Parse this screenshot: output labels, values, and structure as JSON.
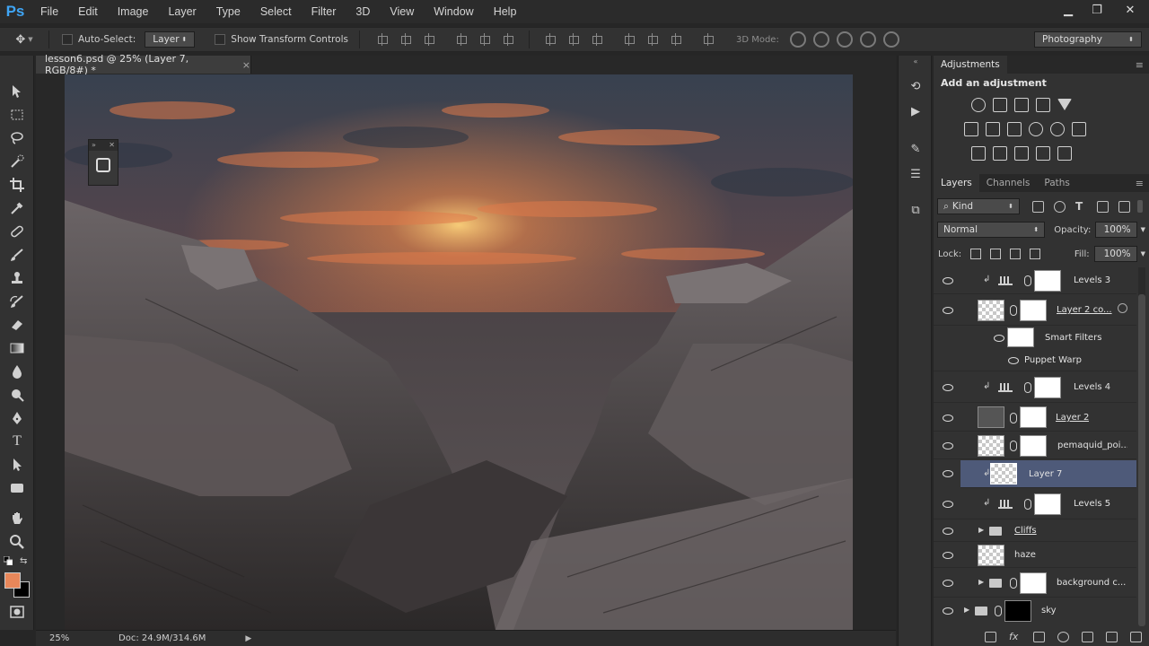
{
  "app": {
    "logo": "Ps",
    "menu": [
      "File",
      "Edit",
      "Image",
      "Layer",
      "Type",
      "Select",
      "Filter",
      "3D",
      "View",
      "Window",
      "Help"
    ],
    "window_controls": [
      "minimize",
      "restore",
      "close"
    ]
  },
  "options_bar": {
    "auto_select_label": "Auto-Select:",
    "auto_select_checked": false,
    "auto_select_value": "Layer",
    "show_transform_label": "Show Transform Controls",
    "show_transform_checked": false,
    "mode_3d_label": "3D Mode:",
    "workspace": "Photography"
  },
  "document": {
    "tab_title": "lesson6.psd @ 25% (Layer 7, RGB/8#) *",
    "close_glyph": "×",
    "zoom": "25%",
    "doc_info": "Doc: 24.9M/314.6M"
  },
  "colors": {
    "foreground": "#e8875a",
    "background": "#000000",
    "selected_layer": "#4e5a79",
    "accent": "#3fa5f5"
  },
  "tools": [
    "move-tool",
    "marquee-tool",
    "lasso-tool",
    "quick-selection-tool",
    "crop-tool",
    "eyedropper-tool",
    "healing-brush-tool",
    "brush-tool",
    "clone-stamp-tool",
    "history-brush-tool",
    "eraser-tool",
    "gradient-tool",
    "blur-tool",
    "dodge-tool",
    "pen-tool",
    "type-tool",
    "path-selection-tool",
    "rectangle-tool",
    "hand-tool",
    "zoom-tool"
  ],
  "adjustments": {
    "tab": "Adjustments",
    "title": "Add an adjustment"
  },
  "layers_panel": {
    "tabs": [
      "Layers",
      "Channels",
      "Paths"
    ],
    "filter_kind": "Kind",
    "blend_mode": "Normal",
    "opacity_label": "Opacity:",
    "opacity_value": "100%",
    "lock_label": "Lock:",
    "fill_label": "Fill:",
    "fill_value": "100%",
    "layers": [
      {
        "name": "Levels 3",
        "type": "adjustment",
        "clipped": true
      },
      {
        "name": "Layer 2 co...",
        "type": "smart-object",
        "underlined": true
      },
      {
        "name": "Smart Filters",
        "type": "smart-filters"
      },
      {
        "name": "Puppet Warp",
        "type": "filter"
      },
      {
        "name": "Levels 4",
        "type": "adjustment",
        "clipped": true
      },
      {
        "name": "Layer 2",
        "type": "smart-object",
        "underlined": true
      },
      {
        "name": "pemaquid_poi...",
        "type": "smart-object"
      },
      {
        "name": "Layer 7",
        "type": "pixel",
        "clipped": true,
        "selected": true
      },
      {
        "name": "Levels 5",
        "type": "adjustment",
        "clipped": true
      },
      {
        "name": "Cliffs",
        "type": "group",
        "underlined": true
      },
      {
        "name": "haze",
        "type": "pixel"
      },
      {
        "name": "background c...",
        "type": "group"
      },
      {
        "name": "sky",
        "type": "group"
      }
    ]
  }
}
